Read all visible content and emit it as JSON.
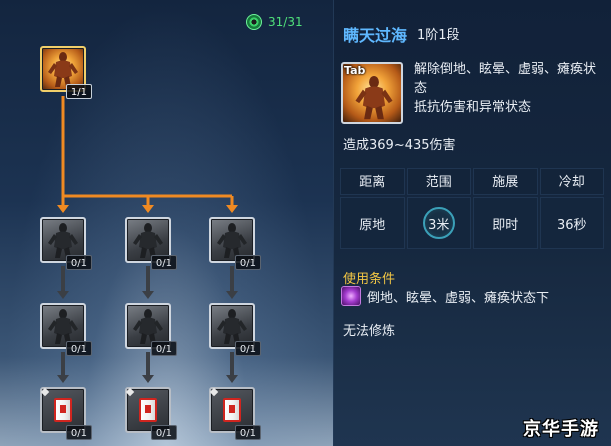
{
  "points": {
    "icon": "skill-point-icon",
    "label": "31/31"
  },
  "tree": {
    "root": {
      "level": "1/1",
      "icon": "warrior-skill-icon"
    },
    "tier1": [
      {
        "level": "0/1"
      },
      {
        "level": "0/1"
      },
      {
        "level": "0/1"
      }
    ],
    "tier2": [
      {
        "level": "0/1"
      },
      {
        "level": "0/1"
      },
      {
        "level": "0/1"
      }
    ],
    "tier3": [
      {
        "level": "0/1"
      },
      {
        "level": "0/1"
      },
      {
        "level": "0/1"
      }
    ]
  },
  "detail": {
    "name": "瞒天过海",
    "rank": "1阶1段",
    "hotkey": "Tab",
    "desc_line1": "解除倒地、眩晕、虚弱、瘫痪状态",
    "desc_line2": "抵抗伤害和异常状态",
    "damage": "造成369~435伤害",
    "stats": {
      "headers": [
        "距离",
        "范围",
        "施展",
        "冷却"
      ],
      "values": [
        "原地",
        "3米",
        "即时",
        "36秒"
      ]
    },
    "condition_title": "使用条件",
    "condition_text": "倒地、眩晕、虚弱、瘫痪状态下",
    "condition_icon": "purple-status-icon",
    "no_train": "无法修炼"
  },
  "colors": {
    "connector": "#f08a22",
    "skill_name": "#5fb8ff",
    "condition_title": "#f3c744",
    "points": "#4fe07a"
  },
  "watermark": "京华手游"
}
